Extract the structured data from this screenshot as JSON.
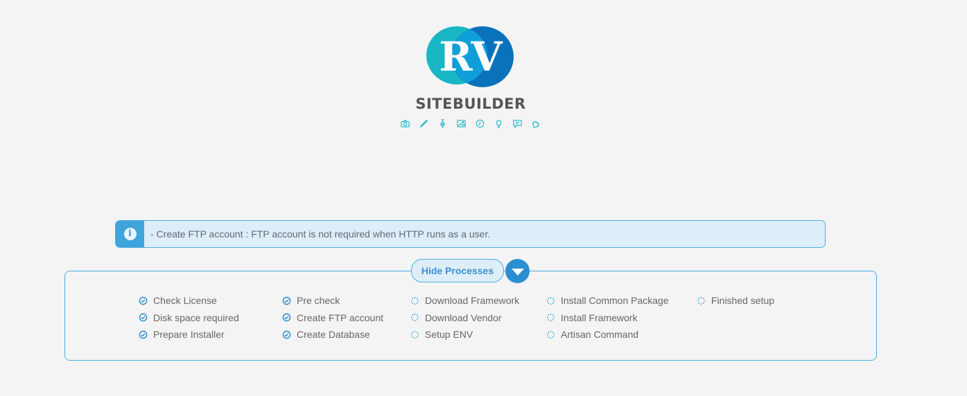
{
  "brand": {
    "logo_letters": "RV",
    "name": "SITEBUILDER",
    "colors": {
      "teal": "#19b6c4",
      "blue": "#0a72bb",
      "text": "#555555"
    },
    "feature_icons": [
      "camera-icon",
      "pen-icon",
      "fountain-pen-icon",
      "image-icon",
      "clock-icon",
      "lightbulb-icon",
      "chat-icon",
      "puzzle-icon"
    ]
  },
  "alert": {
    "icon": "info-icon",
    "message": "- Create FTP account : FTP account is not required when HTTP runs as a user."
  },
  "processes": {
    "hide_label": "Hide Processes",
    "toggle_icon": "caret-down-icon",
    "columns": [
      [
        {
          "label": "Check License",
          "status": "done"
        },
        {
          "label": "Disk space required",
          "status": "done"
        },
        {
          "label": "Prepare Installer",
          "status": "done"
        }
      ],
      [
        {
          "label": "Pre check",
          "status": "done"
        },
        {
          "label": "Create FTP account",
          "status": "done"
        },
        {
          "label": "Create Database",
          "status": "done"
        }
      ],
      [
        {
          "label": "Download Framework",
          "status": "pending"
        },
        {
          "label": "Download Vendor",
          "status": "pending"
        },
        {
          "label": "Setup ENV",
          "status": "pending"
        }
      ],
      [
        {
          "label": "Install Common Package",
          "status": "pending"
        },
        {
          "label": "Install Framework",
          "status": "pending"
        },
        {
          "label": "Artisan Command",
          "status": "pending"
        }
      ],
      [
        {
          "label": "Finished setup",
          "status": "pending"
        }
      ]
    ],
    "colors": {
      "done": "#2a8fd0",
      "pending": "#3fa3dc",
      "border": "#4aaee0"
    }
  }
}
